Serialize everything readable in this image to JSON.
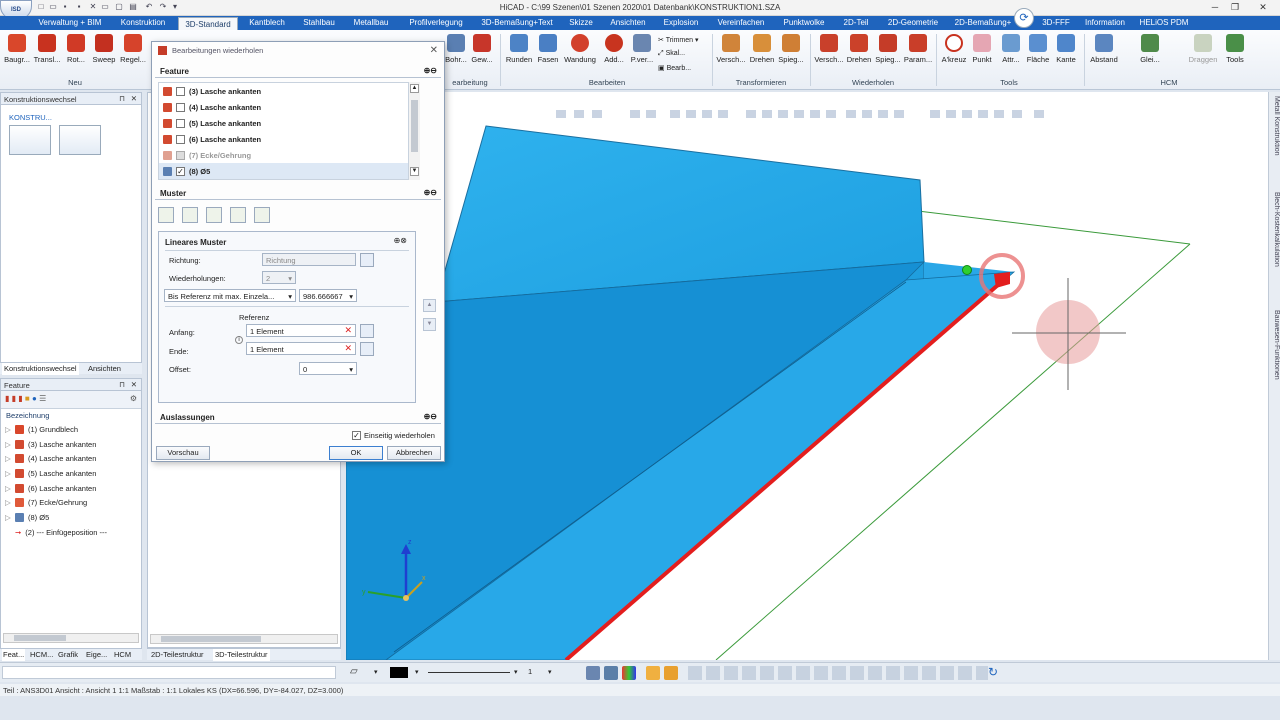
{
  "window": {
    "title": "HiCAD - C:\\99 Szenen\\01 Szenen 2020\\01 Datenbank\\KONSTRUKTION1.SZA",
    "logo": "ISD"
  },
  "tabs": [
    "Verwaltung + BIM",
    "Konstruktion",
    "3D-Standard",
    "Kantblech",
    "Stahlbau",
    "Metallbau",
    "Profilverlegung",
    "3D-Bemaßung+Text",
    "Skizze",
    "Ansichten",
    "Explosion",
    "Vereinfachen",
    "Punktwolke",
    "2D-Teil",
    "2D-Geometrie",
    "2D-Bemaßung+",
    "3D-FFF",
    "Information",
    "HELiOS PDM"
  ],
  "active_tab": "3D-Standard",
  "ribbon": {
    "left_buttons": [
      "Baugr...",
      "Transl...",
      "Rot...",
      "Sweep",
      "Regel..."
    ],
    "left_group": "Neu",
    "partial_buttons": [
      "Bohr...",
      "Gew..."
    ],
    "partial_group": "earbeitung",
    "edit_buttons": [
      "Runden",
      "Fasen",
      "Wandung",
      "Add...",
      "P.ver..."
    ],
    "edit_small": [
      "Trimmen",
      "Skal...",
      "Bearb..."
    ],
    "edit_group": "Bearbeiten",
    "transform_buttons": [
      "Versch...",
      "Drehen",
      "Spieg..."
    ],
    "transform_group": "Transformieren",
    "repeat_buttons": [
      "Versch...",
      "Drehen",
      "Spieg...",
      "Param..."
    ],
    "repeat_group": "Wiederholen",
    "tools_buttons": [
      "A'kreuz",
      "Punkt",
      "Attr...",
      "Fläche",
      "Kante"
    ],
    "tools_group": "Tools",
    "hcm_buttons": [
      "Abstand",
      "Glei...",
      "Draggen",
      "Tools"
    ],
    "hcm_group": "HCM"
  },
  "left_top_panel": {
    "title": "Konstruktionswechsel",
    "tree_label": "KONSTRU...",
    "bottom_tabs": [
      "Konstruktionswechsel",
      "Ansichten"
    ]
  },
  "feature_panel": {
    "title": "Feature",
    "column": "Bezeichnung",
    "items": [
      "(1) Grundblech",
      "(3) Lasche ankanten",
      "(4) Lasche ankanten",
      "(5) Lasche ankanten",
      "(6) Lasche ankanten",
      "(7) Ecke/Gehrung",
      "(8) Ø5",
      "(2) --- Einfügeposition ---"
    ],
    "bottom_tabs": [
      "Feat...",
      "HCM...",
      "Grafik",
      "Eige...",
      "HCM"
    ]
  },
  "middle_tabs": [
    "2D-Teilestruktur",
    "3D-Teilestruktur"
  ],
  "dialog": {
    "title": "Bearbeitungen wiederholen",
    "feature_section": "Feature",
    "feature_items": [
      {
        "label": "(3) Lasche ankanten",
        "checked": false
      },
      {
        "label": "(4) Lasche ankanten",
        "checked": false
      },
      {
        "label": "(5) Lasche ankanten",
        "checked": false
      },
      {
        "label": "(6) Lasche ankanten",
        "checked": false
      },
      {
        "label": "(7) Ecke/Gehrung",
        "checked": false
      },
      {
        "label": "(8) Ø5",
        "checked": true
      }
    ],
    "muster_section": "Muster",
    "linear": {
      "title": "Lineares Muster",
      "richtung_label": "Richtung:",
      "richtung_value": "Richtung",
      "wiederholungen_label": "Wiederholungen:",
      "wiederholungen_value": "2",
      "mode_value": "Bis Referenz mit max. Einzela...",
      "mode_number": "986.666667",
      "referenz_label": "Referenz",
      "anfang_label": "Anfang:",
      "anfang_value": "1 Element",
      "ende_label": "Ende:",
      "ende_value": "1 Element",
      "offset_label": "Offset:",
      "offset_value": "0"
    },
    "auslassungen": "Auslassungen",
    "einseitig": "Einseitig wiederholen",
    "einseitig_checked": true,
    "btn_preview": "Vorschau",
    "btn_ok": "OK",
    "btn_cancel": "Abbrechen"
  },
  "right_tabs": [
    "Metall Konstruktion",
    "Blech-Kostenkalkulation",
    "Bauwesen-Funktionen"
  ],
  "bottom_toolbar": {
    "line_number": "1"
  },
  "status": {
    "text": "Teil : ANS3D01   Ansicht : Ansicht 1 1:1   Maßstab : 1:1   Lokales KS  (DX=66.596, DY=-84.027, DZ=3.000)"
  },
  "colors": {
    "tab_bar": "#1f64bd",
    "model_surface": "#25a9e6",
    "highlight_edge": "#e31e1e"
  }
}
